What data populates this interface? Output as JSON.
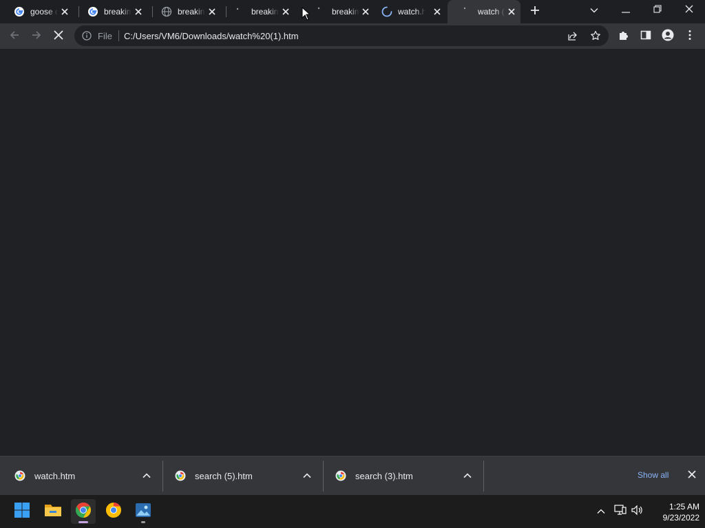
{
  "browser": {
    "tabs": [
      {
        "title": "goose d",
        "favicon": "google-g-icon"
      },
      {
        "title": "breaking",
        "favicon": "google-g-icon"
      },
      {
        "title": "breaking",
        "favicon": "globe-icon"
      },
      {
        "title": "breaking",
        "favicon": "loading-dot-icon"
      },
      {
        "title": "breaking",
        "favicon": "loading-dot-icon"
      },
      {
        "title": "watch.h",
        "favicon": "loading-spinner-icon"
      },
      {
        "title": "watch (",
        "favicon": "loading-dot-icon"
      }
    ],
    "address_bar": {
      "scheme_label": "File",
      "url": "C:/Users/VM6/Downloads/watch%20(1).htm"
    }
  },
  "downloads": {
    "items": [
      {
        "name": "watch.htm"
      },
      {
        "name": "search (5).htm"
      },
      {
        "name": "search (3).htm"
      }
    ],
    "show_all_label": "Show all"
  },
  "taskbar": {
    "time": "1:25 AM",
    "date": "9/23/2022"
  },
  "colors": {
    "accent_link": "#8ab4f8",
    "toolbar": "#35363a",
    "page_bg": "#202124"
  }
}
